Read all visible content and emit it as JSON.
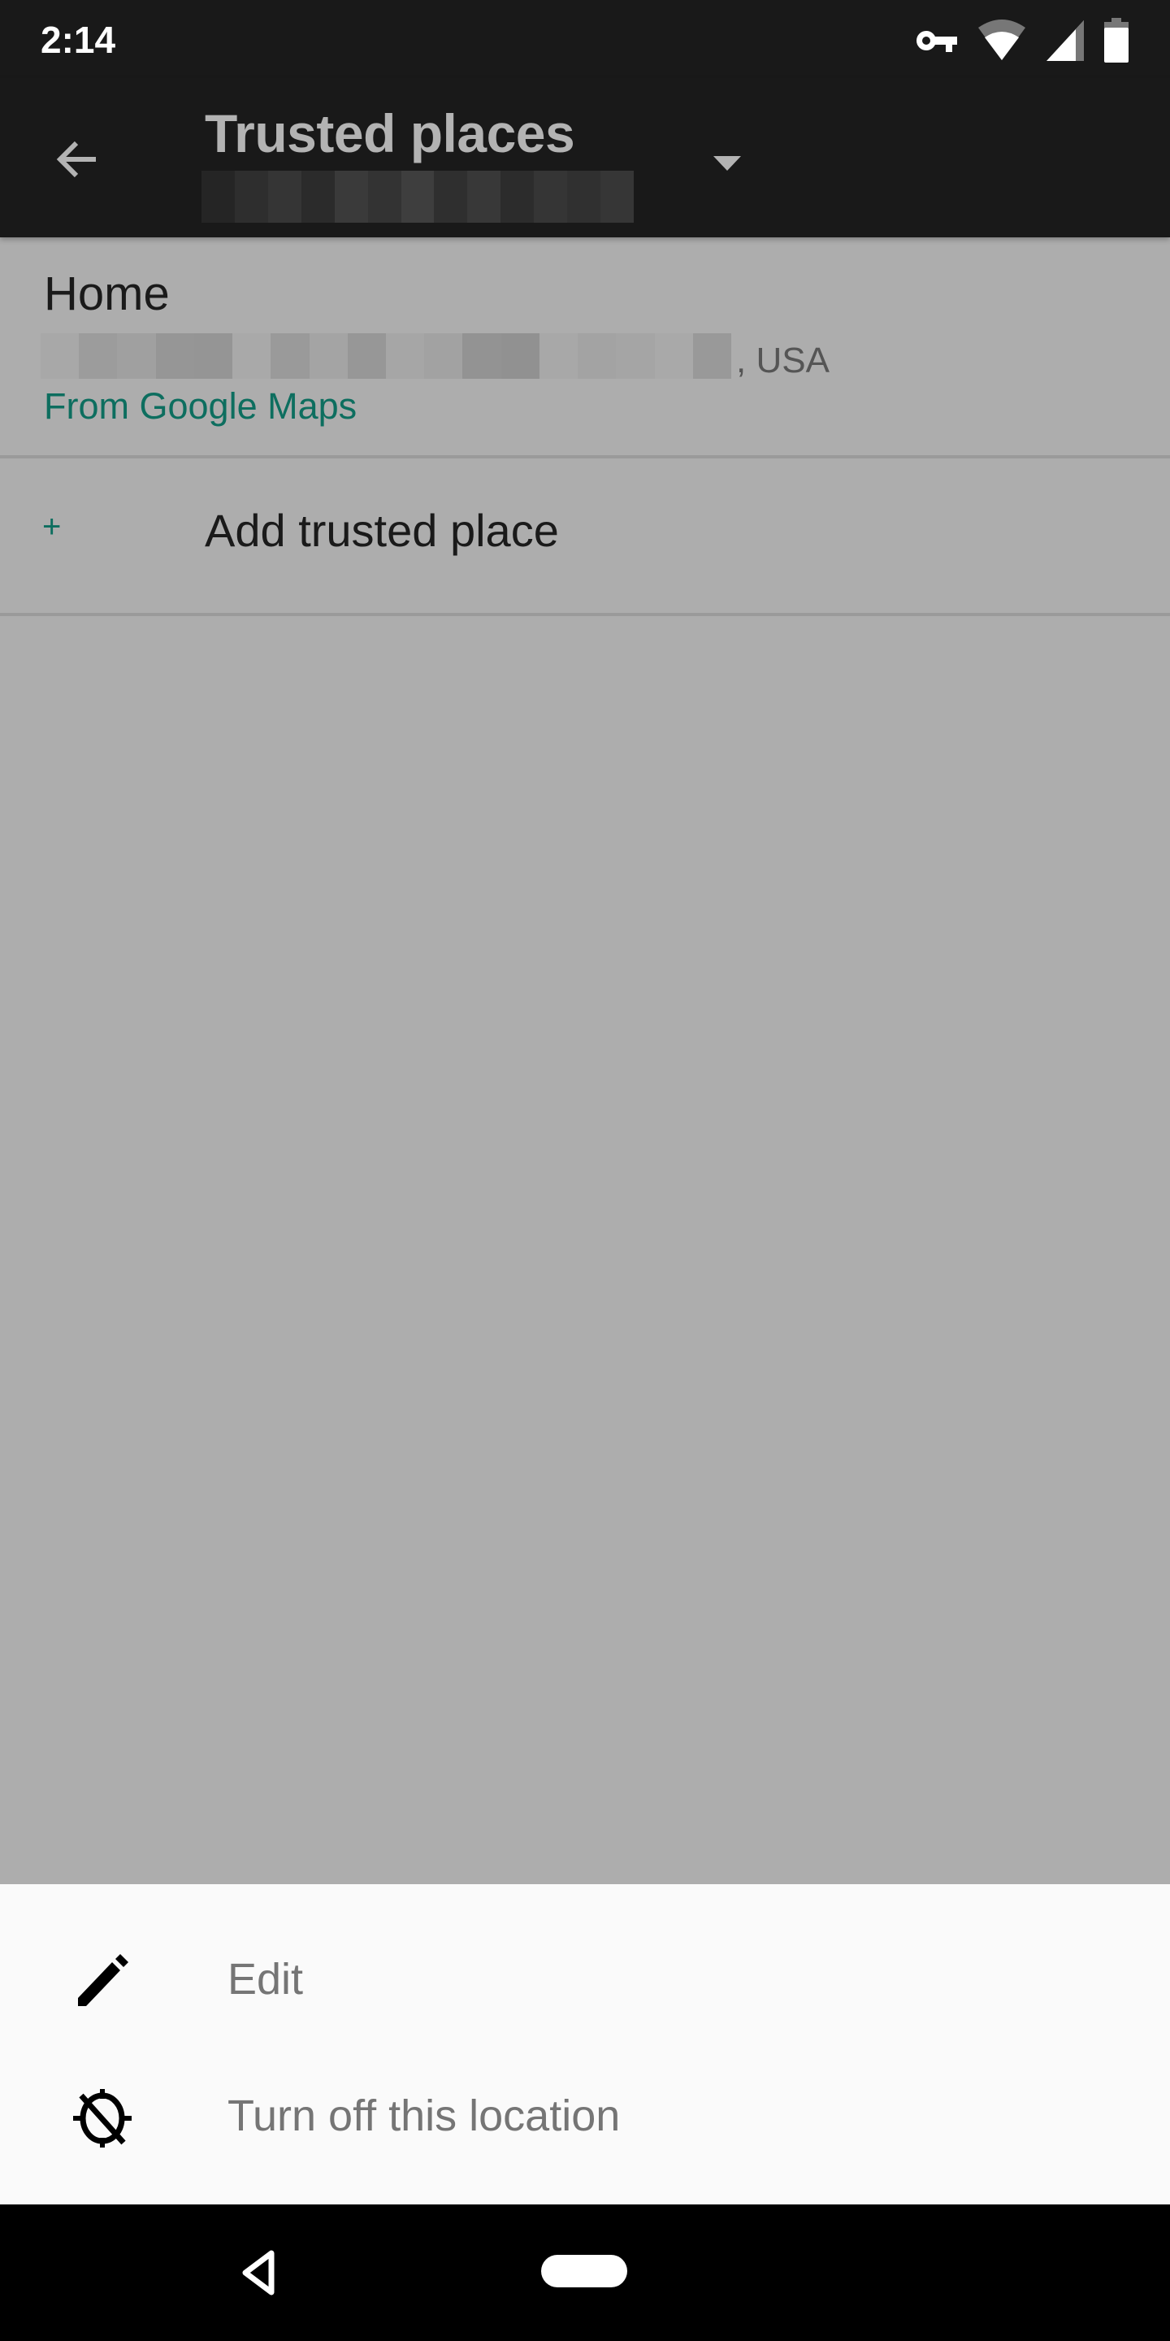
{
  "status_bar": {
    "time": "2:14",
    "icons": [
      "vpn-key-icon",
      "wifi-icon",
      "cell-signal-icon",
      "battery-icon"
    ]
  },
  "app_bar": {
    "back_icon": "arrow-back-icon",
    "title": "Trusted places",
    "subtitle": "[redacted account]",
    "dropdown_icon": "dropdown-triangle-icon"
  },
  "places": [
    {
      "title": "Home",
      "address_redacted": true,
      "address_suffix": ", USA",
      "source": "From Google Maps"
    }
  ],
  "add_place": {
    "icon": "+",
    "label": "Add trusted place"
  },
  "bottom_sheet": {
    "items": [
      {
        "icon": "pencil-icon",
        "label": "Edit"
      },
      {
        "icon": "location-off-icon",
        "label": "Turn off this location"
      }
    ]
  },
  "colors": {
    "accent": "#0d6e5f",
    "app_bar": "#191919",
    "scrim": "#adadad",
    "sheet": "#fafafa"
  }
}
